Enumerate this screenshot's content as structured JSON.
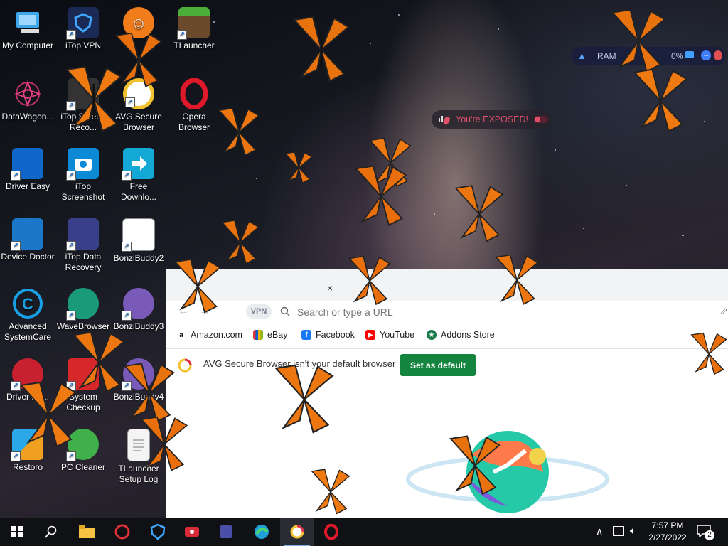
{
  "desktop": {
    "icons": [
      {
        "label": "My Computer"
      },
      {
        "label": "iTop VPN"
      },
      {
        "label": ""
      },
      {
        "label": "TLauncher"
      },
      {
        "label": "DataWagon..."
      },
      {
        "label": "iTop Screen Reco..."
      },
      {
        "label": "AVG Secure Browser"
      },
      {
        "label": "Opera Browser"
      },
      {
        "label": "Driver Easy"
      },
      {
        "label": "iTop Screenshot"
      },
      {
        "label": "Free Downlo..."
      },
      {
        "label": "Device Doctor"
      },
      {
        "label": "iTop Data Recovery"
      },
      {
        "label": "BonziBuddy2"
      },
      {
        "label": "Advanced SystemCare"
      },
      {
        "label": "WaveBrowser"
      },
      {
        "label": "BonziBuddy3"
      },
      {
        "label": "Driver Bo..."
      },
      {
        "label": "System Checkup"
      },
      {
        "label": "BonziBuddy4"
      },
      {
        "label": "Restoro"
      },
      {
        "label": "PC Cleaner"
      },
      {
        "label": "TLauncher Setup Log"
      }
    ]
  },
  "overlays": {
    "exposed_text": "You're EXPOSED!",
    "ram_label": "RAM",
    "ram_value": "0%"
  },
  "browser": {
    "tab_close": "×",
    "vpn_label": "VPN",
    "omnibox_placeholder": "Search or type a URL",
    "bookmarks": [
      {
        "label": "Amazon.com"
      },
      {
        "label": "eBay"
      },
      {
        "label": "Facebook"
      },
      {
        "label": "YouTube"
      },
      {
        "label": "Addons Store"
      }
    ],
    "infobar_text": "AVG Secure Browser isn't your default browser",
    "set_default_label": "Set as default"
  },
  "taskbar": {
    "clock_time": "7:57 PM",
    "clock_date": "2/27/2022",
    "notification_count": "2"
  },
  "colors": {
    "accent_green": "#14843f",
    "exposed_red": "#e0506a",
    "taskbar": "#101114"
  }
}
